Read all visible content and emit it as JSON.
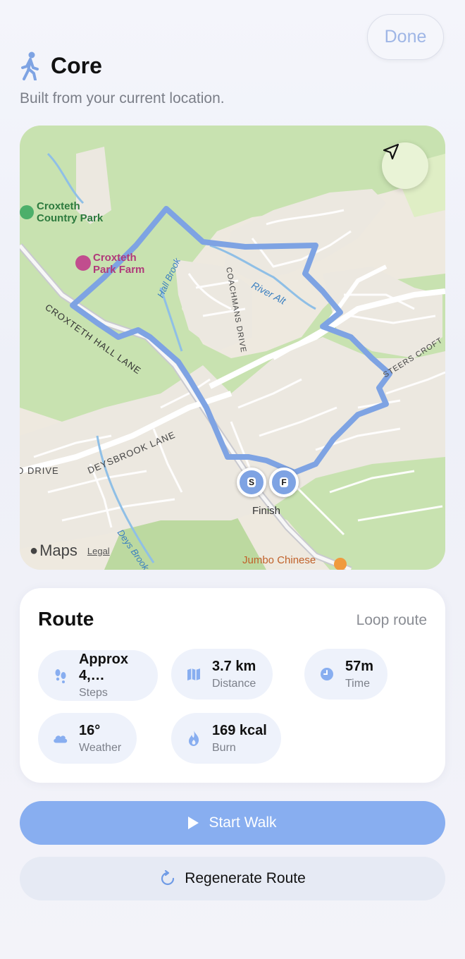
{
  "toolbar": {
    "done_label": "Done"
  },
  "header": {
    "title": "Core",
    "subtitle": "Built from your current location."
  },
  "map": {
    "labels": {
      "park": "Croxteth\nCountry Park",
      "farm": "Croxteth\nPark Farm",
      "croxteth_hall_lane": "CROXTETH HALL LANE",
      "hall_brook": "Hall Brook",
      "coachmans_drive": "COACHMANS DRIVE",
      "river_alt": "River Alt",
      "steers_croft": "STEERS CROFT",
      "deysbrook_lane": "DEYSBROOK LANE",
      "drive": "D DRIVE",
      "deys_brook": "Deys Brook",
      "jumbo": "Jumbo Chinese",
      "finish": "Finish"
    },
    "start_pin": "S",
    "finish_pin": "F",
    "brand": "Maps",
    "legal": "Legal",
    "colors": {
      "route": "#7ea3e3",
      "park": "#c8e2b0",
      "water": "#8fbfe6",
      "land": "#eee9df"
    }
  },
  "route": {
    "title": "Route",
    "type": "Loop route",
    "stats": [
      {
        "value": "Approx 4,…",
        "label": "Steps",
        "icon": "footprints-icon"
      },
      {
        "value": "3.7 km",
        "label": "Distance",
        "icon": "map-icon"
      },
      {
        "value": "57m",
        "label": "Time",
        "icon": "clock-icon"
      },
      {
        "value": "16°",
        "label": "Weather",
        "icon": "cloud-icon"
      },
      {
        "value": "169 kcal",
        "label": "Burn",
        "icon": "flame-icon"
      }
    ]
  },
  "actions": {
    "start_label": "Start Walk",
    "regenerate_label": "Regenerate Route"
  },
  "accent_color": "#88aef0"
}
